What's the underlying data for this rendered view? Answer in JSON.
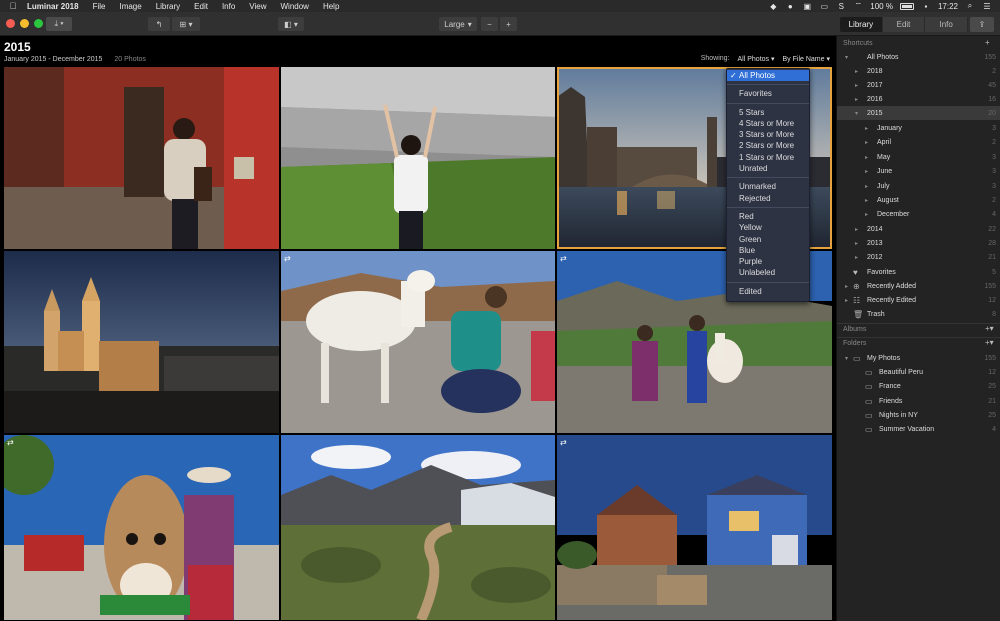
{
  "menubar": {
    "app_name": "Luminar 2018",
    "items": [
      "File",
      "Image",
      "Library",
      "Edit",
      "Info",
      "View",
      "Window",
      "Help"
    ],
    "battery": "100 %",
    "clock": "17:22"
  },
  "toolbar": {
    "zoom_label": "Large",
    "zoom_out": "−",
    "zoom_in": "+",
    "tabs": [
      "Library",
      "Edit",
      "Info"
    ]
  },
  "gallery": {
    "title": "2015",
    "date_range": "January 2015 - December 2015",
    "photo_count": "20 Photos",
    "showing_label": "Showing:",
    "filter_value": "All Photos",
    "sort_value": "By File Name"
  },
  "filter_menu": {
    "checked": "All Photos",
    "groups": [
      [
        "All Photos"
      ],
      [
        "Favorites"
      ],
      [
        "5 Stars",
        "4 Stars or More",
        "3 Stars or More",
        "2 Stars or More",
        "1 Stars or More",
        "Unrated"
      ],
      [
        "Unmarked",
        "Rejected"
      ],
      [
        "Red",
        "Yellow",
        "Green",
        "Blue",
        "Purple",
        "Unlabeled"
      ],
      [
        "Edited"
      ]
    ]
  },
  "sidebar": {
    "shortcuts_header": "Shortcuts",
    "all_photos": {
      "label": "All Photos",
      "count": "155"
    },
    "years": [
      {
        "label": "2018",
        "count": "2"
      },
      {
        "label": "2017",
        "count": "45"
      },
      {
        "label": "2016",
        "count": "16"
      },
      {
        "label": "2015",
        "count": "20"
      }
    ],
    "months": [
      {
        "label": "January",
        "count": "3"
      },
      {
        "label": "April",
        "count": "2"
      },
      {
        "label": "May",
        "count": "3"
      },
      {
        "label": "June",
        "count": "3"
      },
      {
        "label": "July",
        "count": "3"
      },
      {
        "label": "August",
        "count": "2"
      },
      {
        "label": "December",
        "count": "4"
      }
    ],
    "older_years": [
      {
        "label": "2014",
        "count": "22"
      },
      {
        "label": "2013",
        "count": "28"
      },
      {
        "label": "2012",
        "count": "21"
      }
    ],
    "special": [
      {
        "label": "Favorites",
        "count": "5"
      },
      {
        "label": "Recently Added",
        "count": "155"
      },
      {
        "label": "Recently Edited",
        "count": "12"
      },
      {
        "label": "Trash",
        "count": "8"
      }
    ],
    "albums_header": "Albums",
    "folders_header": "Folders",
    "my_photos": {
      "label": "My Photos",
      "count": "155"
    },
    "folders": [
      {
        "label": "Beautiful Peru",
        "count": "12"
      },
      {
        "label": "France",
        "count": "25"
      },
      {
        "label": "Friends",
        "count": "21"
      },
      {
        "label": "Nights in NY",
        "count": "25"
      },
      {
        "label": "Summer Vacation",
        "count": "4"
      }
    ]
  },
  "colors": {
    "accent_selection": "#e6a23c",
    "menu_highlight": "#2f6fd6"
  }
}
